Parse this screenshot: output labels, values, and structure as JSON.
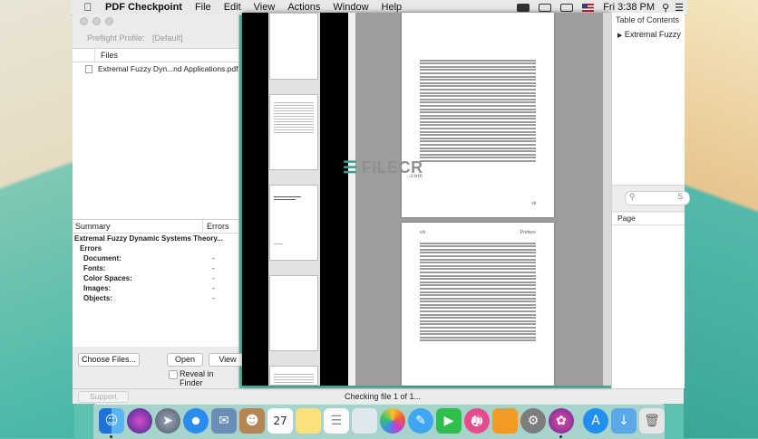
{
  "menubar": {
    "app_name": "PDF Checkpoint",
    "items": [
      "File",
      "Edit",
      "View",
      "Actions",
      "Window",
      "Help"
    ],
    "clock": "Fri 3:38 PM"
  },
  "left_window": {
    "preflight_label": "Preflight Profile:",
    "preflight_value": "[Default]",
    "files_header": "Files",
    "file_name": "Extremal Fuzzy Dyn...nd Applications.pdf",
    "summary_header": "Summary",
    "errors_header": "Errors",
    "summary_title": "Extremal Fuzzy Dynamic Systems Theory...",
    "errors_label": "Errors",
    "rows": [
      {
        "label": "Document:",
        "value": "-"
      },
      {
        "label": "Fonts:",
        "value": "-"
      },
      {
        "label": "Color Spaces:",
        "value": "-"
      },
      {
        "label": "Images:",
        "value": "-"
      },
      {
        "label": "Objects:",
        "value": "-"
      }
    ],
    "choose_files": "Choose Files...",
    "open": "Open",
    "view": "View",
    "reveal": "Reveal in Finder",
    "support": "Support"
  },
  "status": "Checking file 1 of 1...",
  "toc": {
    "title": "Table of Contents",
    "item": "Extremal Fuzzy",
    "search_placeholder": "S",
    "page_header": "Page"
  },
  "pages": {
    "page1_number": "vii",
    "page2_left_number": "viii",
    "page2_right_label": "Preface"
  },
  "watermark": {
    "text": "FILECR",
    "sub": ".com"
  },
  "colors": {
    "desktop_teal": "#5ec2b0",
    "window_gray": "#ececec",
    "viewer_gray": "#9d9d9d"
  },
  "dock_icons": [
    "finder-icon",
    "siri-icon",
    "launchpad-icon",
    "safari-icon",
    "mail-icon",
    "contacts-icon",
    "calendar-icon",
    "notes-icon",
    "reminders-icon",
    "preview-icon",
    "photos-icon",
    "messages-icon",
    "facetime-icon",
    "itunes-icon",
    "ibooks-icon",
    "system-preferences-icon",
    "pdf-checkpoint-icon",
    "app-store-icon",
    "downloads-folder-icon",
    "trash-icon"
  ],
  "calendar_date": "27"
}
